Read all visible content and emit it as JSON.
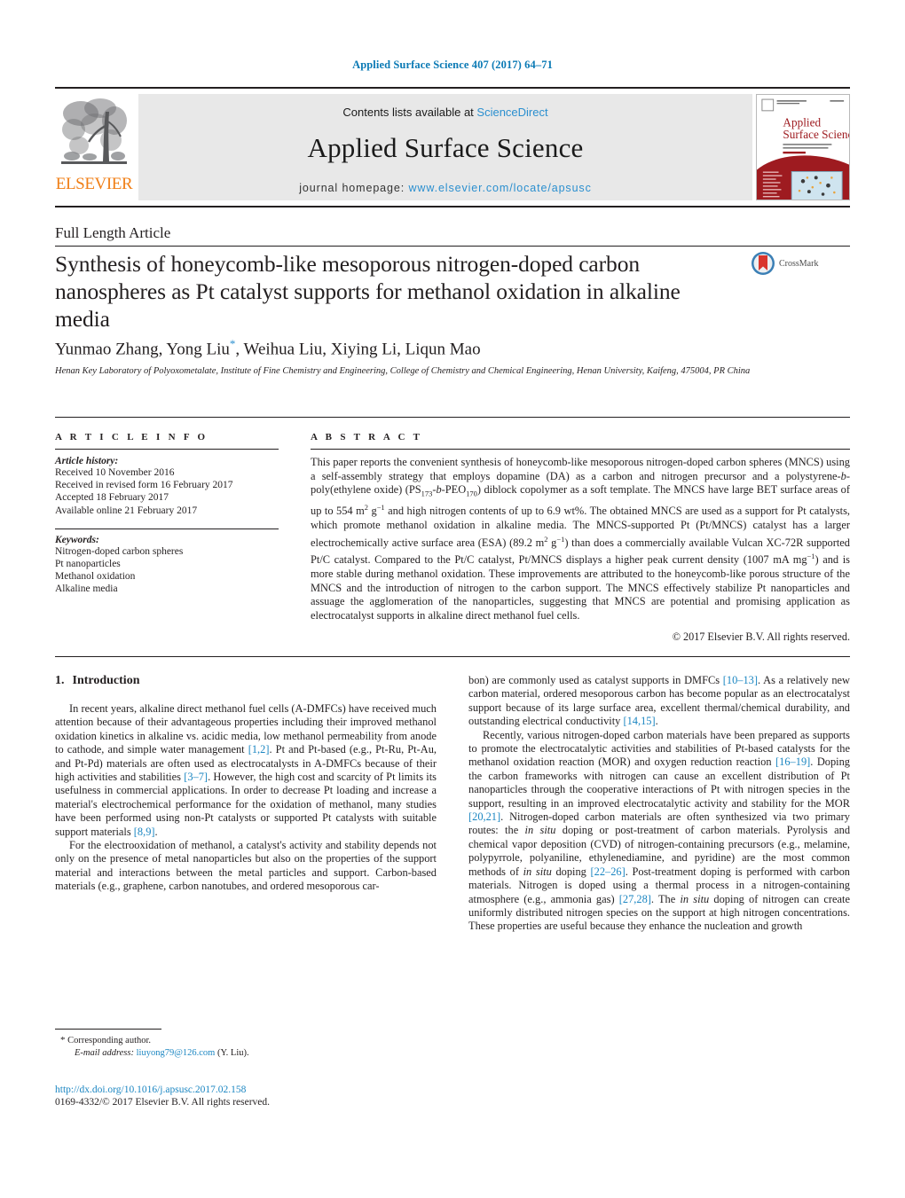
{
  "running_head": "Applied Surface Science 407 (2017) 64–71",
  "masthead": {
    "publisher_name": "ELSEVIER",
    "contents_prefix": "Contents lists available at ",
    "contents_link": "ScienceDirect",
    "journal_title": "Applied Surface Science",
    "homepage_prefix": "journal homepage: ",
    "homepage_url": "www.elsevier.com/locate/apsusc",
    "cover_title_line1": "Applied",
    "cover_title_line2": "Surface Science"
  },
  "article": {
    "type_label": "Full Length Article",
    "title": "Synthesis of honeycomb-like mesoporous nitrogen-doped carbon nanospheres as Pt catalyst supports for methanol oxidation in alkaline media",
    "crossmark_label": "CrossMark",
    "authors": "Yunmao Zhang, Yong Liu",
    "authors_tail": ", Weihua Liu, Xiying Li, Liqun Mao",
    "corresponding_marker": "*",
    "affiliation": "Henan Key Laboratory of Polyoxometalate, Institute of Fine Chemistry and Engineering, College of Chemistry and Chemical Engineering, Henan University, Kaifeng, 475004, PR China"
  },
  "article_info": {
    "heading": "A R T I C L E    I N F O",
    "history_label": "Article history:",
    "history": [
      "Received 10 November 2016",
      "Received in revised form 16 February 2017",
      "Accepted 18 February 2017",
      "Available online 21 February 2017"
    ],
    "keywords_label": "Keywords:",
    "keywords": [
      "Nitrogen-doped carbon spheres",
      "Pt nanoparticles",
      "Methanol oxidation",
      "Alkaline media"
    ]
  },
  "abstract": {
    "heading": "A B S T R A C T",
    "part1": "This paper reports the convenient synthesis of honeycomb-like mesoporous nitrogen-doped carbon spheres (MNCS) using a self-assembly strategy that employs dopamine (DA) as a carbon and nitrogen precursor and a polystyrene-",
    "italic_b1": "b",
    "part2": "-poly(ethylene oxide) (PS",
    "sub1": "173",
    "italic_b2": "b",
    "part3": "-PEO",
    "sub2": "170",
    "part4": ") diblock copolymer as a soft template. The MNCS have large BET surface areas of up to 554 m",
    "sup1": "2",
    "part5": " g",
    "sup2": "−1",
    "part6": " and high nitrogen contents of up to 6.9 wt%. The obtained MNCS are used as a support for Pt catalysts, which promote methanol oxidation in alkaline media. The MNCS-supported Pt (Pt/MNCS) catalyst has a larger electrochemically active surface area (ESA) (89.2 m",
    "sup3": "2",
    "part7": " g",
    "sup4": "−1",
    "part8": ") than does a commercially available Vulcan XC-72R supported Pt/C catalyst. Compared to the Pt/C catalyst, Pt/MNCS displays a higher peak current density (1007 mA mg",
    "sup5": "−1",
    "part9": ") and is more stable during methanol oxidation. These improvements are attributed to the honeycomb-like porous structure of the MNCS and the introduction of nitrogen to the carbon support. The MNCS effectively stabilize Pt nanoparticles and assuage the agglomeration of the nanoparticles, suggesting that MNCS are potential and promising application as electrocatalyst supports in alkaline direct methanol fuel cells.",
    "copyright": "© 2017 Elsevier B.V. All rights reserved."
  },
  "introduction": {
    "number": "1.",
    "heading": "Introduction",
    "left_p1_a": "In recent years, alkaline direct methanol fuel cells (A-DMFCs) have received much attention because of their advantageous properties including their improved methanol oxidation kinetics in alkaline vs. acidic media, low methanol permeability from anode to cathode, and simple water management ",
    "ref_1_2": "[1,2]",
    "left_p1_b": ". Pt and Pt-based (e.g., Pt-Ru, Pt-Au, and Pt-Pd) materials are often used as electrocatalysts in A-DMFCs because of their high activities and stabilities ",
    "ref_3_7": "[3–7]",
    "left_p1_c": ". However, the high cost and scarcity of Pt limits its usefulness in commercial applications. In order to decrease Pt loading and increase a material's electrochemical performance for the oxidation of methanol, many studies have been performed using non-Pt catalysts or supported Pt catalysts with suitable support materials ",
    "ref_8_9": "[8,9]",
    "left_p1_d": ".",
    "left_p2": "For the electrooxidation of methanol, a catalyst's activity and stability depends not only on the presence of metal nanoparticles but also on the properties of the support material and interactions between the metal particles and support. Carbon-based materials (e.g., graphene, carbon nanotubes, and ordered mesoporous car-",
    "right_p1_a": "bon) are commonly used as catalyst supports in DMFCs ",
    "ref_10_13": "[10–13]",
    "right_p1_b": ". As a relatively new carbon material, ordered mesoporous carbon has become popular as an electrocatalyst support because of its large surface area, excellent thermal/chemical durability, and outstanding electrical conductivity ",
    "ref_14_15": "[14,15]",
    "right_p1_c": ".",
    "right_p2_a": "Recently, various nitrogen-doped carbon materials have been prepared as supports to promote the electrocatalytic activities and stabilities of Pt-based catalysts for the methanol oxidation reaction (MOR) and oxygen reduction reaction ",
    "ref_16_19": "[16–19]",
    "right_p2_b": ". Doping the carbon frameworks with nitrogen can cause an excellent distribution of Pt nanoparticles through the cooperative interactions of Pt with nitrogen species in the support, resulting in an improved electrocatalytic activity and stability for the MOR ",
    "ref_20_21": "[20,21]",
    "right_p2_c": ". Nitrogen-doped carbon materials are often synthesized via two primary routes: the ",
    "italic_insitu1": "in situ",
    "right_p2_d": " doping or post-treatment of carbon materials. Pyrolysis and chemical vapor deposition (CVD) of nitrogen-containing precursors (e.g., melamine, polypyrrole, polyaniline, ethylenediamine, and pyridine) are the most common methods of ",
    "italic_insitu2": "in situ",
    "right_p2_e": " doping ",
    "ref_22_26": "[22–26]",
    "right_p2_f": ". Post-treatment doping is performed with carbon materials. Nitrogen is doped using a thermal process in a nitrogen-containing atmosphere (e.g., ammonia gas) ",
    "ref_27_28": "[27,28]",
    "right_p2_g": ". The ",
    "italic_insitu3": "in situ",
    "right_p2_h": " doping of nitrogen can create uniformly distributed nitrogen species on the support at high nitrogen concentrations. These properties are useful because they enhance the nucleation and growth"
  },
  "footnote": {
    "star": "*",
    "corresponding": "Corresponding author.",
    "email_label": "E-mail address:",
    "email": "liuyong79@126.com",
    "email_suffix": "(Y. Liu)."
  },
  "footer": {
    "doi": "http://dx.doi.org/10.1016/j.apsusc.2017.02.158",
    "issn_line": "0169-4332/© 2017 Elsevier B.V. All rights reserved."
  },
  "colors": {
    "link_blue": "#1b86c2",
    "sciencedirect_blue": "#2b8fcf",
    "elsevier_orange": "#f07f17",
    "ink": "#231f20",
    "panel_grey": "#e8e8e8"
  }
}
